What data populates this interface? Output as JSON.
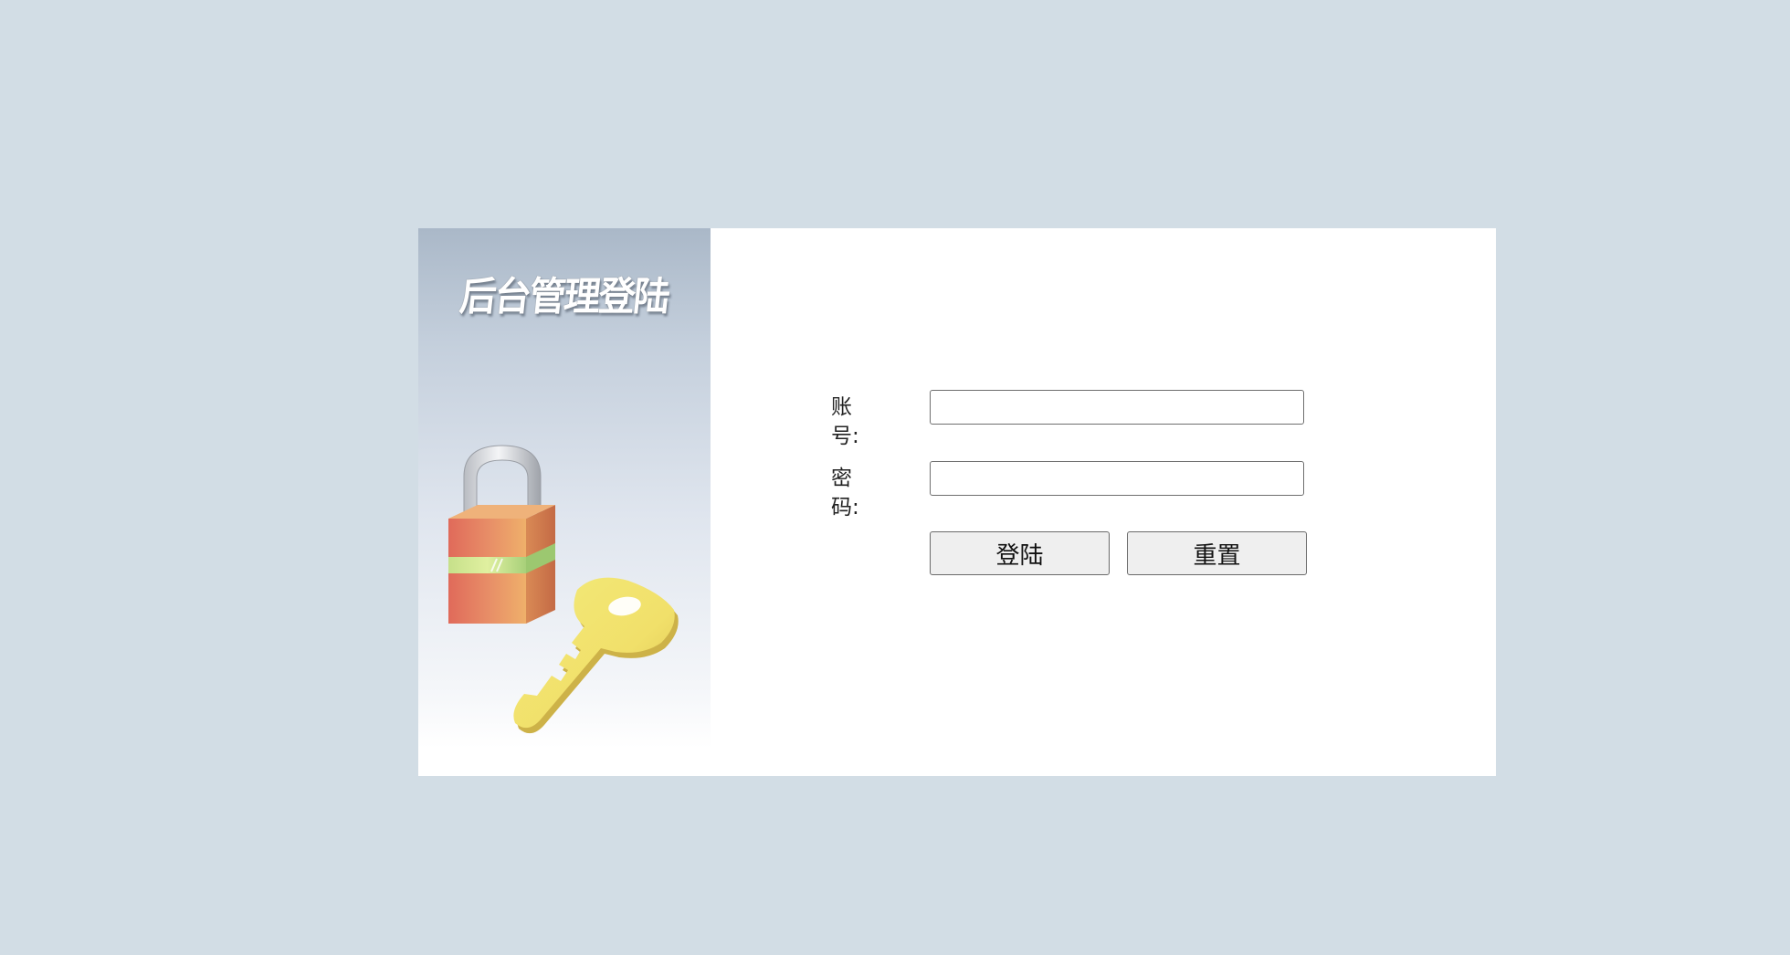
{
  "panel": {
    "title": "后台管理登陆",
    "illustration": "padlock-and-key-icon"
  },
  "form": {
    "account_label": "账号:",
    "account_value": "",
    "password_label": "密码:",
    "password_value": "",
    "login_button": "登陆",
    "reset_button": "重置"
  },
  "colors": {
    "page_background": "#d2dde5",
    "card_background": "#ffffff",
    "panel_gradient_top": "#aab8c8",
    "button_background": "#efefef"
  }
}
